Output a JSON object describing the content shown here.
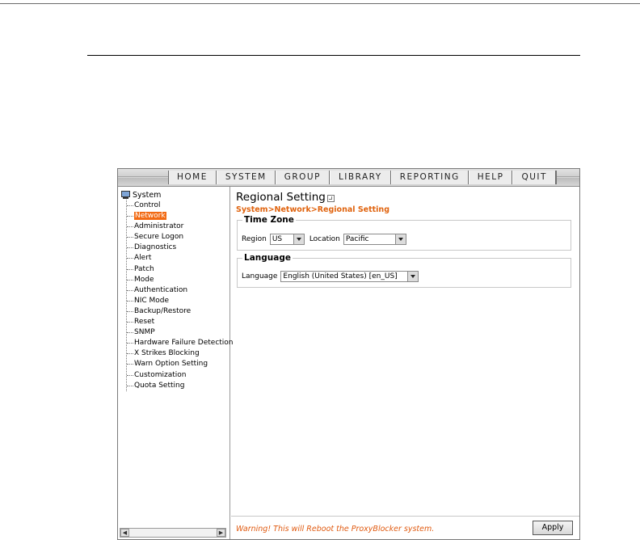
{
  "menu": {
    "items": [
      "HOME",
      "SYSTEM",
      "GROUP",
      "LIBRARY",
      "REPORTING",
      "HELP",
      "QUIT"
    ]
  },
  "sidebar": {
    "root_label": "System",
    "root_icon": "computer-icon",
    "selected": "Network",
    "items": [
      "Control",
      "Network",
      "Administrator",
      "Secure Logon",
      "Diagnostics",
      "Alert",
      "Patch",
      "Mode",
      "Authentication",
      "NIC Mode",
      "Backup/Restore",
      "Reset",
      "SNMP",
      "Hardware Failure Detection",
      "X Strikes Blocking",
      "Warn Option Setting",
      "Customization",
      "Quota Setting"
    ]
  },
  "content": {
    "title": "Regional Setting",
    "breadcrumb": "System>Network>Regional Setting",
    "time_zone": {
      "legend": "Time Zone",
      "region_label": "Region",
      "region_value": "US",
      "location_label": "Location",
      "location_value": "Pacific"
    },
    "language": {
      "legend": "Language",
      "language_label": "Language",
      "language_value": "English (United States) [en_US]"
    },
    "footer": {
      "warning": "Warning! This will Reboot the ProxyBlocker system.",
      "apply_label": "Apply"
    }
  },
  "colors": {
    "accent": "#e0630e",
    "selected_bg": "#f26a13"
  }
}
